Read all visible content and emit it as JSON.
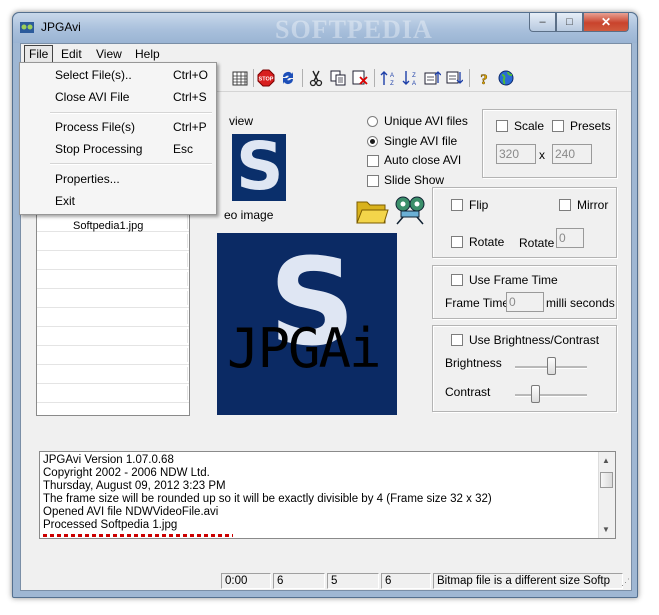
{
  "window": {
    "title": "JPGAvi",
    "watermark": "SOFTPEDIA",
    "controls": {
      "minimize": "–",
      "maximize": "□",
      "close": "✕"
    }
  },
  "menubar": {
    "file": "File",
    "edit": "Edit",
    "view": "View",
    "help": "Help"
  },
  "file_menu": {
    "items": [
      {
        "label": "Select File(s)..",
        "shortcut": "Ctrl+O"
      },
      {
        "label": "Close AVI File",
        "shortcut": "Ctrl+S"
      },
      {
        "label": "Process File(s)",
        "shortcut": "Ctrl+P"
      },
      {
        "label": "Stop Processing",
        "shortcut": "Esc"
      },
      {
        "label": "Properties...",
        "shortcut": ""
      },
      {
        "label": "Exit",
        "shortcut": ""
      }
    ]
  },
  "toolbar": {
    "icons": [
      "calendar-grid-icon",
      "stop-icon",
      "refresh-icon",
      "cut-icon",
      "copy-icon",
      "delete-icon",
      "sort-ascending-icon",
      "sort-descending-icon",
      "move-up-icon",
      "move-down-icon",
      "help-icon",
      "web-icon"
    ]
  },
  "files": {
    "partial_item": "Softpedia1.jpg"
  },
  "preview": {
    "label_partial": "view",
    "video_label_partial": "eo image",
    "thumb_letter": "S",
    "big_text": "JPGAi"
  },
  "output_mode": {
    "unique": "Unique AVI files",
    "single": "Single AVI file",
    "auto_close": "Auto close AVI",
    "slide_show": "Slide Show",
    "selected": "single"
  },
  "size": {
    "scale_label": "Scale",
    "presets_label": "Presets",
    "width": "320",
    "times": "x",
    "height": "240"
  },
  "transform": {
    "flip": "Flip",
    "mirror": "Mirror",
    "rotate_check": "Rotate",
    "rotate_label": "Rotate",
    "rotate_value": "0"
  },
  "frame_time": {
    "use_label": "Use Frame Time",
    "label": "Frame Time",
    "value": "0",
    "unit": "milli seconds"
  },
  "brightness": {
    "use_label": "Use Brightness/Contrast",
    "brightness_label": "Brightness",
    "contrast_label": "Contrast",
    "brightness_level": 0.5,
    "contrast_level": 0.25
  },
  "log": {
    "lines": [
      "JPGAvi Version   1.07.0.68",
      "Copyright  2002 - 2006 NDW Ltd.",
      "Thursday, August 09, 2012 3:23 PM",
      "The frame size will be rounded up so it will be exactly divisible by 4 (Frame size 32 x 32)",
      "Opened AVI file NDWVideoFile.avi",
      "Processed Softpedia 1.jpg"
    ]
  },
  "status": {
    "time": "0:00",
    "a": "6",
    "b": "5",
    "c": "6",
    "message": "Bitmap file is a different size Softp"
  },
  "colors": {
    "preview_bg": "#0b2a64",
    "title_gradient": "#a9c0dc",
    "close": "#c9432c"
  }
}
